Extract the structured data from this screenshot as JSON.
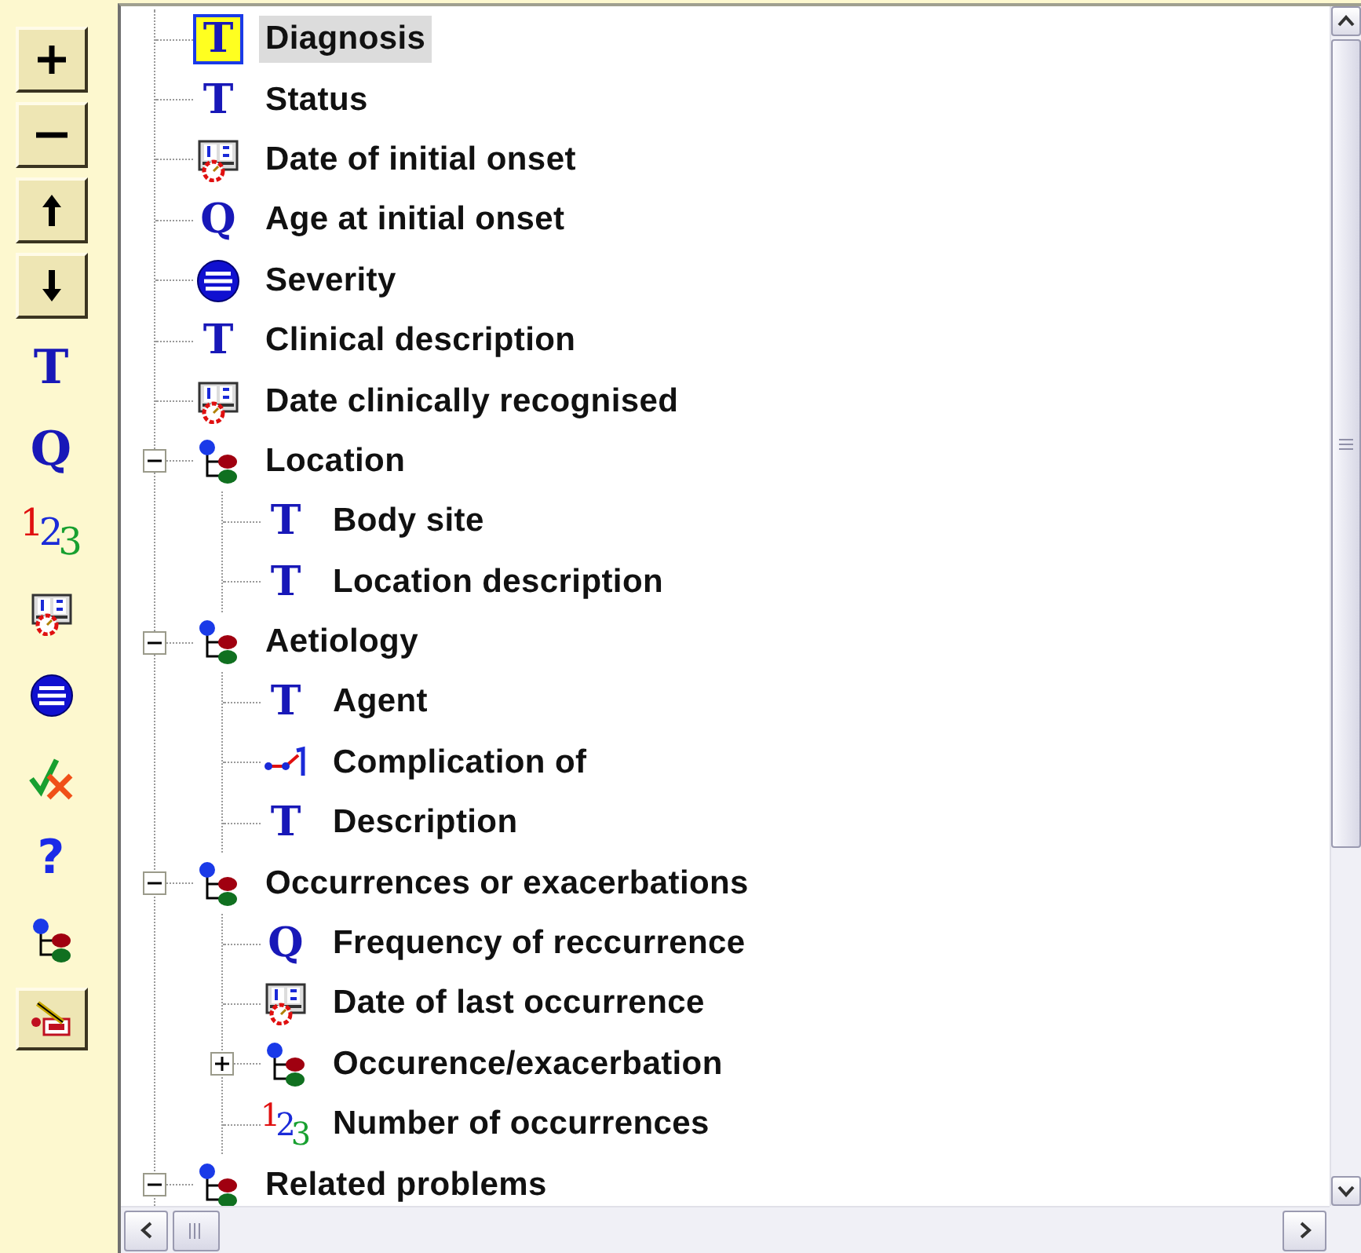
{
  "toolbar": [
    {
      "kind": "add"
    },
    {
      "kind": "remove"
    },
    {
      "kind": "move-up"
    },
    {
      "kind": "move-down"
    },
    {
      "kind": "text",
      "glyph": "T"
    },
    {
      "kind": "quantity",
      "glyph": "Q"
    },
    {
      "kind": "number",
      "glyph": "123"
    },
    {
      "kind": "date"
    },
    {
      "kind": "choice"
    },
    {
      "kind": "boolean"
    },
    {
      "kind": "help",
      "glyph": "?"
    },
    {
      "kind": "group"
    },
    {
      "kind": "edit"
    }
  ],
  "tree": [
    {
      "label": "Diagnosis",
      "kind": "text",
      "glyph": "T",
      "selected": true
    },
    {
      "label": "Status",
      "kind": "text",
      "glyph": "T",
      "selected": false
    },
    {
      "label": "Date of initial onset",
      "kind": "date",
      "selected": false
    },
    {
      "label": "Age at initial onset",
      "kind": "quantity",
      "glyph": "Q",
      "selected": false
    },
    {
      "label": "Severity",
      "kind": "choice",
      "selected": false
    },
    {
      "label": "Clinical description",
      "kind": "text",
      "glyph": "T",
      "selected": false
    },
    {
      "label": "Date clinically recognised",
      "kind": "date",
      "selected": false
    },
    {
      "label": "Location",
      "kind": "group",
      "selected": false,
      "expanded": true,
      "children": [
        {
          "label": "Body site",
          "kind": "text",
          "glyph": "T",
          "selected": false
        },
        {
          "label": "Location description",
          "kind": "text",
          "glyph": "T",
          "selected": false
        }
      ]
    },
    {
      "label": "Aetiology",
      "kind": "group",
      "selected": false,
      "expanded": true,
      "children": [
        {
          "label": "Agent",
          "kind": "text",
          "glyph": "T",
          "selected": false
        },
        {
          "label": "Complication of",
          "kind": "link",
          "selected": false
        },
        {
          "label": "Description",
          "kind": "text",
          "glyph": "T",
          "selected": false
        }
      ]
    },
    {
      "label": "Occurrences or exacerbations",
      "kind": "group",
      "selected": false,
      "expanded": true,
      "children": [
        {
          "label": "Frequency of reccurrence",
          "kind": "quantity",
          "glyph": "Q",
          "selected": false
        },
        {
          "label": "Date of last occurrence",
          "kind": "date",
          "selected": false
        },
        {
          "label": "Occurence/exacerbation",
          "kind": "group",
          "selected": false,
          "expanded": false
        },
        {
          "label": "Number of occurrences",
          "kind": "number",
          "glyph": "123",
          "selected": false
        }
      ]
    },
    {
      "label": "Related problems",
      "kind": "group",
      "selected": false,
      "expanded": true
    }
  ]
}
